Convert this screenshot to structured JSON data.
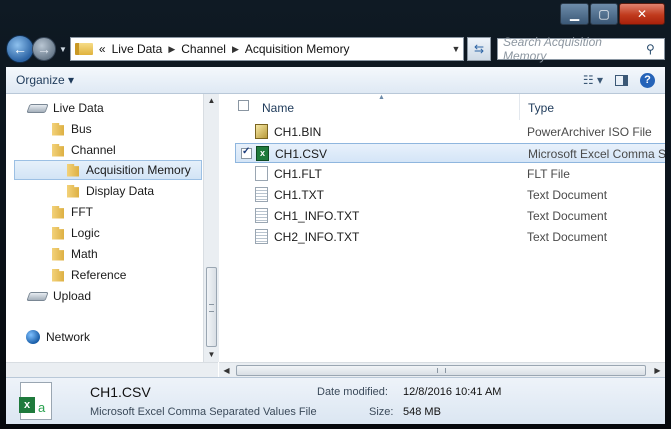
{
  "window": {
    "minimize_icon": "minimize-icon",
    "maximize_icon": "maximize-icon",
    "close_icon": "close-icon"
  },
  "address": {
    "overflow": "«",
    "crumbs": [
      "Live Data",
      "Channel",
      "Acquisition Memory"
    ],
    "separator": "▶"
  },
  "search": {
    "placeholder": "Search Acquisition Memory"
  },
  "toolbar": {
    "organize": "Organize ▾"
  },
  "nav": {
    "items": [
      {
        "label": "Live Data",
        "icon": "drive-icon"
      },
      {
        "label": "Bus",
        "icon": "folder-icon"
      },
      {
        "label": "Channel",
        "icon": "folder-icon"
      },
      {
        "label": "Acquisition Memory",
        "icon": "folder-icon",
        "selected": true
      },
      {
        "label": "Display Data",
        "icon": "folder-icon"
      },
      {
        "label": "FFT",
        "icon": "folder-icon"
      },
      {
        "label": "Logic",
        "icon": "folder-icon"
      },
      {
        "label": "Math",
        "icon": "folder-icon"
      },
      {
        "label": "Reference",
        "icon": "folder-icon"
      },
      {
        "label": "Upload",
        "icon": "drive-icon"
      },
      {
        "label": "Network",
        "icon": "network-icon"
      }
    ]
  },
  "files": {
    "columns": {
      "name": "Name",
      "type": "Type"
    },
    "rows": [
      {
        "name": "CH1.BIN",
        "type": "PowerArchiver ISO File",
        "icon": "iso-file-icon"
      },
      {
        "name": "CH1.CSV",
        "type": "Microsoft Excel Comma S...",
        "icon": "excel-file-icon",
        "selected": true
      },
      {
        "name": "CH1.FLT",
        "type": "FLT File",
        "icon": "blank-file-icon"
      },
      {
        "name": "CH1.TXT",
        "type": "Text Document",
        "icon": "text-file-icon"
      },
      {
        "name": "CH1_INFO.TXT",
        "type": "Text Document",
        "icon": "text-file-icon"
      },
      {
        "name": "CH2_INFO.TXT",
        "type": "Text Document",
        "icon": "text-file-icon"
      }
    ]
  },
  "details": {
    "name": "CH1.CSV",
    "type": "Microsoft Excel Comma Separated Values File",
    "modified_label": "Date modified:",
    "modified_value": "12/8/2016 10:41 AM",
    "size_label": "Size:",
    "size_value": "548 MB"
  },
  "colors": {
    "accent": "#2563b8",
    "excel": "#1f7a3c",
    "selection": "#d2e4f6"
  }
}
